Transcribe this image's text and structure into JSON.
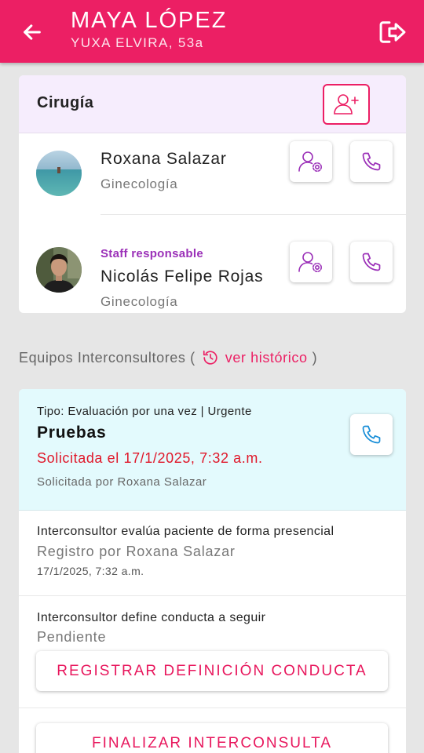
{
  "header": {
    "patient_name": "MAYA LÓPEZ",
    "patient_subtitle": "YUXA ELVIRA, 53a",
    "back_icon": "arrow-left-icon",
    "logout_icon": "logout-icon"
  },
  "surgery": {
    "title": "Cirugía",
    "add_icon": "add-user-icon",
    "staff": [
      {
        "name": "Roxana Salazar",
        "specialty": "Ginecología",
        "role": ""
      },
      {
        "name": "Nicolás Felipe Rojas",
        "specialty": "Ginecología",
        "role": "Staff responsable"
      }
    ]
  },
  "interconsult": {
    "heading": "Equipos Interconsultores (",
    "heading_close": ")",
    "history_link": "ver histórico",
    "type": "Tipo: Evaluación por una vez | Urgente",
    "title": "Pruebas",
    "requested_at": "Solicitada el 17/1/2025, 7:32 a.m.",
    "requested_by": "Solicitada por Roxana Salazar",
    "steps": [
      {
        "title": "Interconsultor evalúa paciente de forma presencial",
        "status": "Registro por Roxana Salazar",
        "date": "17/1/2025, 7:32 a.m."
      },
      {
        "title": "Interconsultor define conducta a seguir",
        "status": "Pendiente",
        "action": "REGISTRAR DEFINICIÓN CONDUCTA"
      }
    ],
    "finalize_label": "FINALIZAR INTERCONSULTA"
  },
  "colors": {
    "brand": "#ec1f64",
    "purple": "#9b30b8",
    "alert": "#e0182a",
    "call_blue": "#1a8fd8"
  }
}
